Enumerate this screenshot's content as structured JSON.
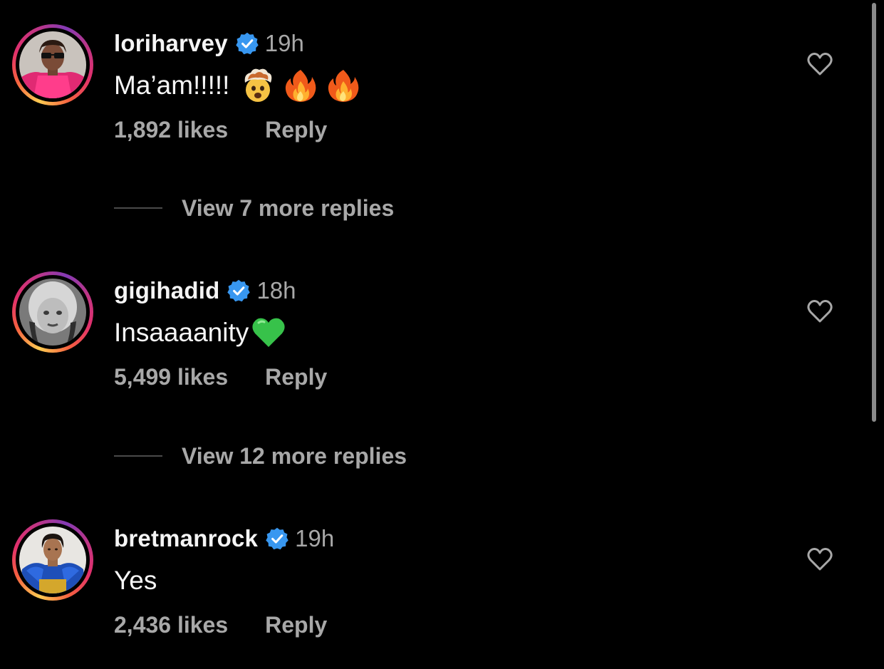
{
  "comments": [
    {
      "username": "loriharvey",
      "verified": true,
      "time": "19h",
      "text": "Ma’am!!!!!",
      "emojis": [
        "exploding-head",
        "fire",
        "fire"
      ],
      "likes": "1,892 likes",
      "reply_label": "Reply",
      "view_replies": "View 7 more replies"
    },
    {
      "username": "gigihadid",
      "verified": true,
      "time": "18h",
      "text": "Insaaaanity",
      "emojis": [
        "green-heart"
      ],
      "likes": "5,499 likes",
      "reply_label": "Reply",
      "view_replies": "View 12 more replies"
    },
    {
      "username": "bretmanrock",
      "verified": true,
      "time": "19h",
      "text": "Yes",
      "emojis": [],
      "likes": "2,436 likes",
      "reply_label": "Reply"
    }
  ],
  "icons": {
    "verified": "verified-badge-icon",
    "like": "heart-outline-icon"
  },
  "colors": {
    "background": "#000000",
    "primary_text": "#f5f5f5",
    "secondary_text": "#a8a8a8",
    "verified_blue": "#3897f0",
    "story_ring": [
      "#fdcb52",
      "#f56040",
      "#e1306c",
      "#c13584",
      "#833ab4"
    ]
  }
}
